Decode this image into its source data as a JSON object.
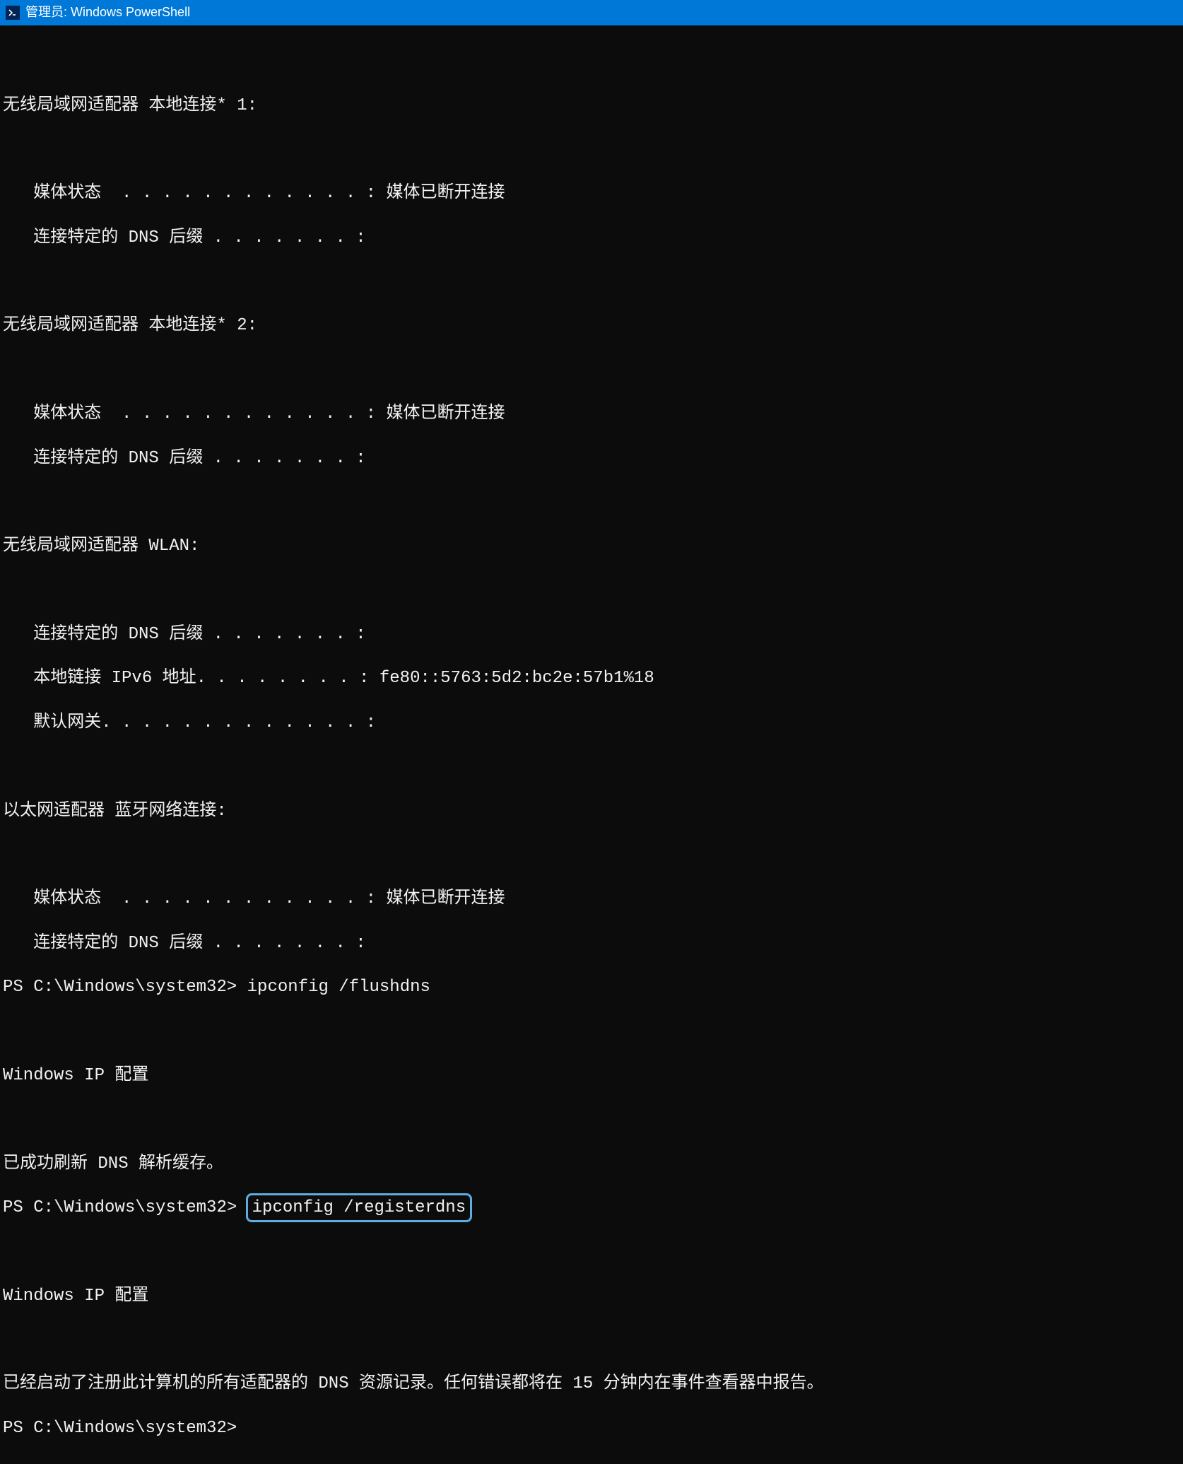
{
  "titlebar": {
    "icon": ">_",
    "text": "管理员: Windows PowerShell"
  },
  "terminal": {
    "blank": "",
    "adapter1_header": "无线局域网适配器 本地连接* 1:",
    "adapter1_media": "   媒体状态  . . . . . . . . . . . . : 媒体已断开连接",
    "adapter1_dns": "   连接特定的 DNS 后缀 . . . . . . . :",
    "adapter2_header": "无线局域网适配器 本地连接* 2:",
    "adapter2_media": "   媒体状态  . . . . . . . . . . . . : 媒体已断开连接",
    "adapter2_dns": "   连接特定的 DNS 后缀 . . . . . . . :",
    "wlan_header": "无线局域网适配器 WLAN:",
    "wlan_dns": "   连接特定的 DNS 后缀 . . . . . . . :",
    "wlan_ipv6": "   本地链接 IPv6 地址. . . . . . . . : fe80::5763:5d2:bc2e:57b1%18",
    "wlan_gateway": "   默认网关. . . . . . . . . . . . . :",
    "bt_header": "以太网适配器 蓝牙网络连接:",
    "bt_media": "   媒体状态  . . . . . . . . . . . . : 媒体已断开连接",
    "bt_dns": "   连接特定的 DNS 后缀 . . . . . . . :",
    "prompt1_pre": "PS C:\\Windows\\system32> ",
    "prompt1_cmd": "ipconfig /flushdns",
    "ipcfg_header1": "Windows IP 配置",
    "flush_success": "已成功刷新 DNS 解析缓存。",
    "prompt2_pre": "PS C:\\Windows\\system32> ",
    "prompt2_cmd": "ipconfig /registerdns",
    "ipcfg_header2": "Windows IP 配置",
    "register_msg": "已经启动了注册此计算机的所有适配器的 DNS 资源记录。任何错误都将在 15 分钟内在事件查看器中报告。",
    "prompt3": "PS C:\\Windows\\system32>"
  }
}
